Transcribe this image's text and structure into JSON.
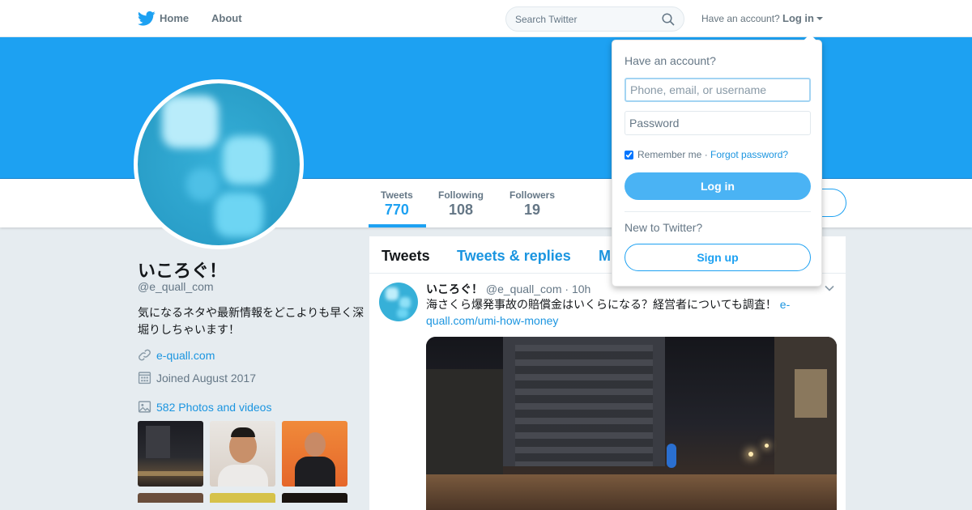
{
  "nav": {
    "home": "Home",
    "about": "About",
    "search_placeholder": "Search Twitter",
    "have_account": "Have an account?",
    "login": "Log in"
  },
  "profile": {
    "name": "いころぐ！",
    "handle": "@e_quall_com",
    "bio": "気になるネタや最新情報をどこよりも早く深堀りしちゃいます！",
    "website": "e-quall.com",
    "joined": "Joined August 2017",
    "photos_label": "582 Photos and videos"
  },
  "stats": [
    {
      "label": "Tweets",
      "value": "770"
    },
    {
      "label": "Following",
      "value": "108"
    },
    {
      "label": "Followers",
      "value": "19"
    }
  ],
  "tabs": {
    "tweets": "Tweets",
    "tweets_replies": "Tweets & replies",
    "media": "M"
  },
  "tweet": {
    "name": "いころぐ！",
    "handle": "@e_quall_com",
    "sep": "·",
    "time": "10h",
    "text": "海さくら爆発事故の賠償金はいくらになる？経営者についても調査！ ",
    "link": "e-quall.com/umi-how-money"
  },
  "login_dropdown": {
    "title": "Have an account?",
    "username_placeholder": "Phone, email, or username",
    "password_placeholder": "Password",
    "remember": "Remember me",
    "dot": " · ",
    "forgot": "Forgot password?",
    "login_button": "Log in",
    "new_to": "New to Twitter?",
    "signup_button": "Sign up"
  },
  "colors": {
    "brand_blue": "#1da1f2",
    "link_blue": "#1b95e0",
    "login_button": "#4ab3f4"
  },
  "icons": [
    "twitter-bird-icon",
    "search-icon",
    "link-icon",
    "calendar-icon",
    "photo-icon",
    "chevron-down-icon"
  ]
}
